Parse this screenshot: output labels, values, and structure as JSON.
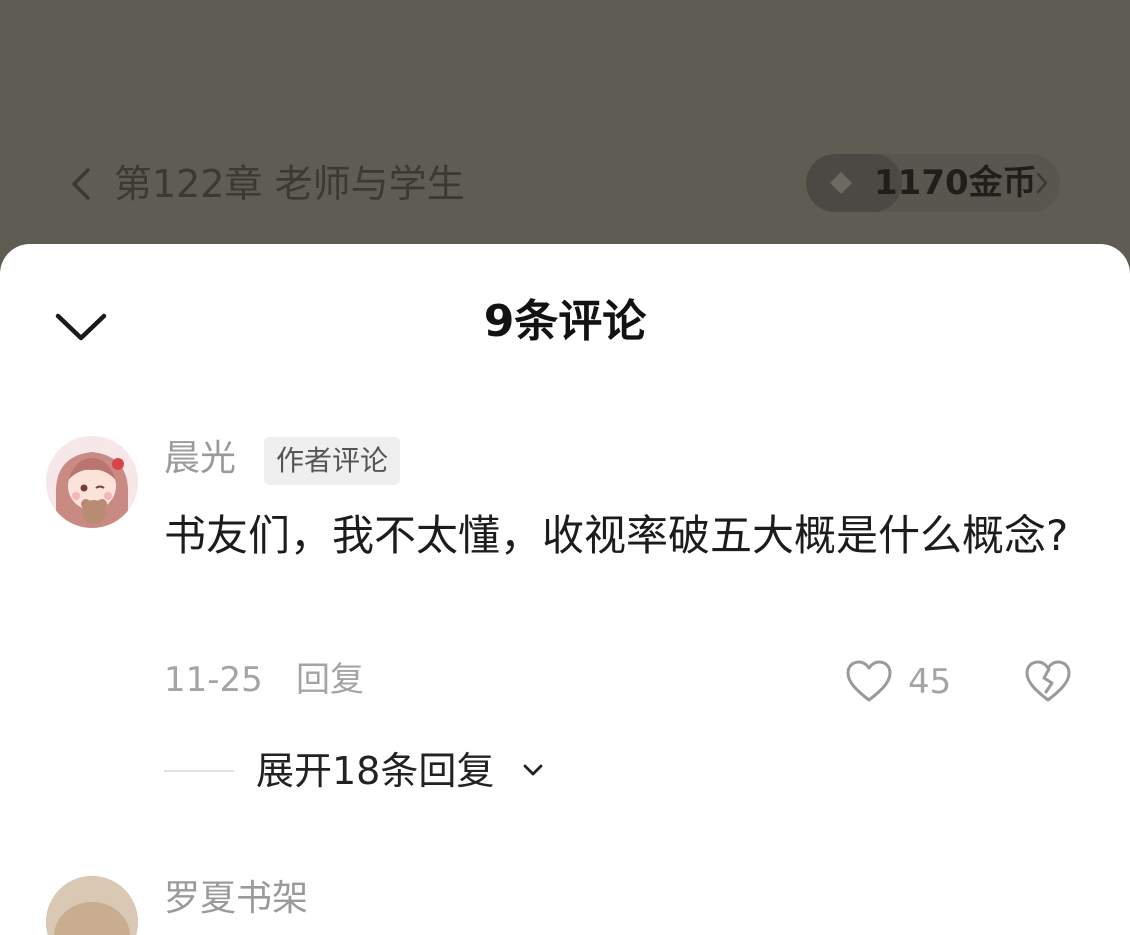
{
  "header": {
    "chapter_title": "第122章 老师与学生",
    "coins": "1170金币",
    "icons": {
      "back": "chevron-left-icon",
      "coin": "coin-diamond-icon",
      "coins_more": "chevron-right-icon"
    }
  },
  "sheet": {
    "title": "9条评论",
    "collapse_icon": "chevron-down-icon"
  },
  "comments": [
    {
      "username": "晨光",
      "tag": "作者评论",
      "text": "书友们，我不太懂，收视率破五大概是什么概念?",
      "date": "11-25",
      "reply_label": "回复",
      "likes": "45",
      "expand_label": "展开18条回复",
      "icons": {
        "like": "heart-icon",
        "dislike": "broken-heart-icon",
        "expand": "chevron-down-icon"
      }
    },
    {
      "username": "罗夏书架"
    }
  ],
  "colors": {
    "dim_background": "#5f5c53",
    "sheet_background": "#ffffff",
    "muted_text": "#a4a4a4",
    "primary_text": "#1c1c1c"
  }
}
